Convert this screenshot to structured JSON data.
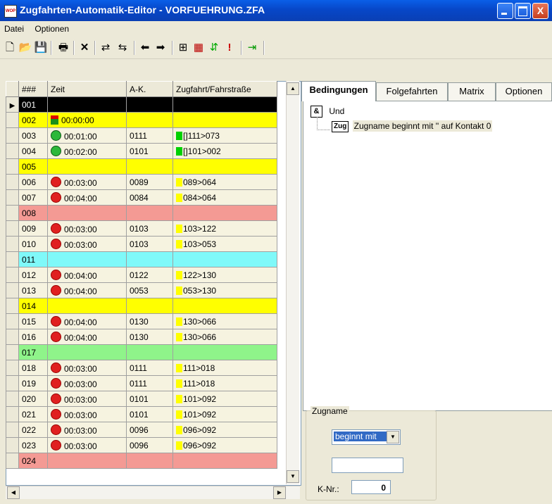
{
  "window": {
    "title": "Zugfahrten-Automatik-Editor - VORFUEHRUNG.ZFA",
    "app_icon_text": "WOP",
    "close_glyph": "X"
  },
  "menu": [
    "Datei",
    "Optionen"
  ],
  "toolbar_icons": [
    "new-icon",
    "open-icon",
    "save-icon",
    "print-icon",
    "delete-icon",
    "insert-row-icon",
    "insert-row-after-icon",
    "arrow-left-icon",
    "arrow-right-icon",
    "network-icon",
    "table-icon",
    "swap-icon",
    "alert-icon",
    "exit-icon"
  ],
  "grid": {
    "headers": [
      "###",
      "Zeit",
      "A-K.",
      "Zugfahrt/Fahrstraße"
    ],
    "rows": [
      {
        "no": "001",
        "zeit": "",
        "ak": "",
        "zf": "",
        "color": "black",
        "icon": "",
        "bar": "",
        "current": true
      },
      {
        "no": "002",
        "zeit": "00:00:00",
        "ak": "",
        "zf": "",
        "color": "yellow",
        "icon": "signal",
        "bar": ""
      },
      {
        "no": "003",
        "zeit": "00:01:00",
        "ak": "0111",
        "zf": "[]111>073",
        "color": "norm",
        "icon": "green",
        "bar": "g"
      },
      {
        "no": "004",
        "zeit": "00:02:00",
        "ak": "0101",
        "zf": "[]101>002",
        "color": "norm",
        "icon": "green",
        "bar": "g"
      },
      {
        "no": "005",
        "zeit": "",
        "ak": "",
        "zf": "",
        "color": "yellow",
        "icon": "",
        "bar": ""
      },
      {
        "no": "006",
        "zeit": "00:03:00",
        "ak": "0089",
        "zf": "089>064",
        "color": "norm",
        "icon": "red",
        "bar": "y"
      },
      {
        "no": "007",
        "zeit": "00:04:00",
        "ak": "0084",
        "zf": "084>064",
        "color": "norm",
        "icon": "red",
        "bar": "y"
      },
      {
        "no": "008",
        "zeit": "",
        "ak": "",
        "zf": "",
        "color": "salmon",
        "icon": "",
        "bar": ""
      },
      {
        "no": "009",
        "zeit": "00:03:00",
        "ak": "0103",
        "zf": "103>122",
        "color": "norm",
        "icon": "red",
        "bar": "y"
      },
      {
        "no": "010",
        "zeit": "00:03:00",
        "ak": "0103",
        "zf": "103>053",
        "color": "norm",
        "icon": "red",
        "bar": "y"
      },
      {
        "no": "011",
        "zeit": "",
        "ak": "",
        "zf": "",
        "color": "cyan",
        "icon": "",
        "bar": ""
      },
      {
        "no": "012",
        "zeit": "00:04:00",
        "ak": "0122",
        "zf": "122>130",
        "color": "norm",
        "icon": "red",
        "bar": "y"
      },
      {
        "no": "013",
        "zeit": "00:04:00",
        "ak": "0053",
        "zf": "053>130",
        "color": "norm",
        "icon": "red",
        "bar": "y"
      },
      {
        "no": "014",
        "zeit": "",
        "ak": "",
        "zf": "",
        "color": "yellow",
        "icon": "",
        "bar": ""
      },
      {
        "no": "015",
        "zeit": "00:04:00",
        "ak": "0130",
        "zf": "130>066",
        "color": "norm",
        "icon": "red",
        "bar": "y"
      },
      {
        "no": "016",
        "zeit": "00:04:00",
        "ak": "0130",
        "zf": "130>066",
        "color": "norm",
        "icon": "red",
        "bar": "y"
      },
      {
        "no": "017",
        "zeit": "",
        "ak": "",
        "zf": "",
        "color": "green",
        "icon": "",
        "bar": ""
      },
      {
        "no": "018",
        "zeit": "00:03:00",
        "ak": "0111",
        "zf": "111>018",
        "color": "norm",
        "icon": "red",
        "bar": "y"
      },
      {
        "no": "019",
        "zeit": "00:03:00",
        "ak": "0111",
        "zf": "111>018",
        "color": "norm",
        "icon": "red",
        "bar": "y"
      },
      {
        "no": "020",
        "zeit": "00:03:00",
        "ak": "0101",
        "zf": "101>092",
        "color": "norm",
        "icon": "red",
        "bar": "y"
      },
      {
        "no": "021",
        "zeit": "00:03:00",
        "ak": "0101",
        "zf": "101>092",
        "color": "norm",
        "icon": "red",
        "bar": "y"
      },
      {
        "no": "022",
        "zeit": "00:03:00",
        "ak": "0096",
        "zf": "096>092",
        "color": "norm",
        "icon": "red",
        "bar": "y"
      },
      {
        "no": "023",
        "zeit": "00:03:00",
        "ak": "0096",
        "zf": "096>092",
        "color": "norm",
        "icon": "red",
        "bar": "y"
      },
      {
        "no": "024",
        "zeit": "",
        "ak": "",
        "zf": "",
        "color": "salmon",
        "icon": "",
        "bar": ""
      }
    ]
  },
  "tabs": [
    "Bedingungen",
    "Folgefahrten",
    "Matrix",
    "Optionen"
  ],
  "tree": {
    "and_icon": "&",
    "and_label": "Und",
    "zug_icon": "Zug",
    "zug_label": "Zugname beginnt mit '' auf Kontakt 0"
  },
  "zugname": {
    "legend": "Zugname",
    "combo_value": "beginnt mit",
    "text_value": "",
    "knr_label": "K-Nr.:",
    "knr_value": "0"
  }
}
